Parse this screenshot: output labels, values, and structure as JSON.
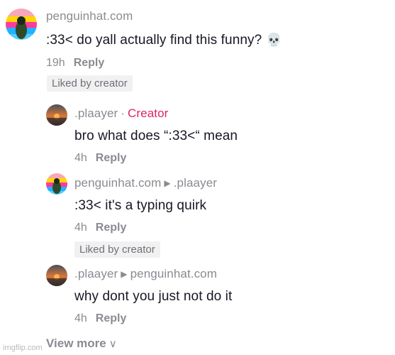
{
  "comments": [
    {
      "username": "penguinhat.com",
      "text": ":33< do yall actually find this funny?",
      "emoji": "💀",
      "time": "19h",
      "reply": "Reply",
      "liked": "Liked by creator"
    },
    {
      "username": ".plaayer",
      "creator_badge": "Creator",
      "text": "bro what does “:33<“ mean",
      "time": "4h",
      "reply": "Reply"
    },
    {
      "username": "penguinhat.com",
      "reply_to": ".plaayer",
      "text": ":33< it's a typing quirk",
      "time": "4h",
      "reply": "Reply",
      "liked": "Liked by creator"
    },
    {
      "username": ".plaayer",
      "reply_to": "penguinhat.com",
      "text": "why dont you just not do it",
      "time": "4h",
      "reply": "Reply"
    }
  ],
  "view_more": "View more",
  "watermark": "imgflip.com",
  "icons": {
    "skull": "skull-emoji-icon",
    "reply_arrow": "triangle-right-icon",
    "view_more": "chevron-down-icon"
  }
}
